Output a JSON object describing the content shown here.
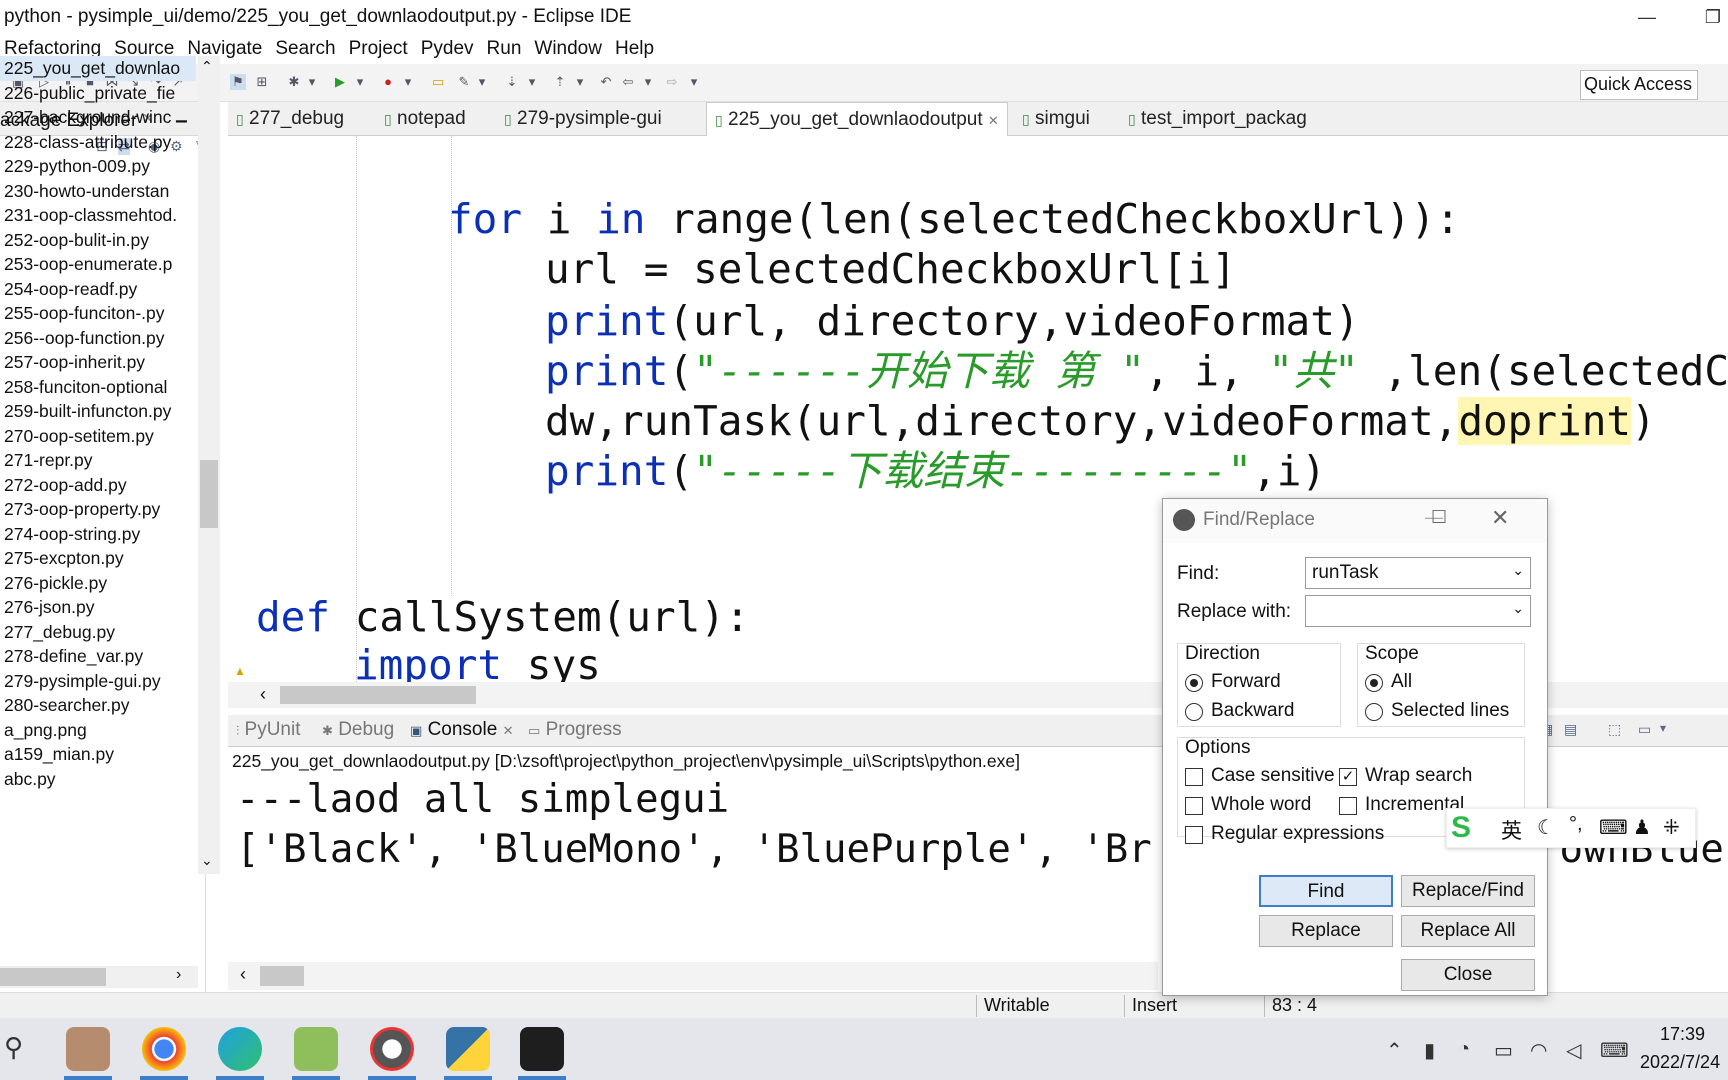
{
  "window": {
    "title": "python - pysimple_ui/demo/225_you_get_downlaodoutput.py - Eclipse IDE"
  },
  "menu": [
    "Refactoring",
    "Source",
    "Navigate",
    "Search",
    "Project",
    "Pydev",
    "Run",
    "Window",
    "Help"
  ],
  "toolbar": {
    "quick_access": "Quick Access"
  },
  "package_explorer": {
    "title": "ackage Explorer",
    "items": [
      "225_you_get_downlao",
      "226-public_private_fie",
      "227-background-winc",
      "228-class-attribute.py",
      "229-python-009.py",
      "230-howto-understan",
      "231-oop-classmehtod.",
      "252-oop-bulit-in.py",
      "253-oop-enumerate.p",
      "254-oop-readf.py",
      "255-oop-funciton-.py",
      "256--oop-function.py",
      "257-oop-inherit.py",
      "258-funciton-optional",
      "259-built-infuncton.py",
      "270-oop-setitem.py",
      "271-repr.py",
      "272-oop-add.py",
      "273-oop-property.py",
      "274-oop-string.py",
      "275-excpton.py",
      "276-pickle.py",
      "276-json.py",
      "277_debug.py",
      "278-define_var.py",
      "279-pysimple-gui.py",
      "280-searcher.py",
      "a_png.png",
      "a159_mian.py",
      "abc.py"
    ]
  },
  "editor_tabs": [
    "277_debug",
    "notepad",
    "279-pysimple-gui",
    "225_you_get_downlaodoutput",
    "simgui",
    "test_import_packag"
  ],
  "code": {
    "l1": {
      "kw1": "for",
      "t1": " i ",
      "kw2": "in",
      "t2": " range(len(selectedCheckboxUrl)):"
    },
    "l2": "url = selectedCheckboxUrl[i]",
    "l3": {
      "kw": "print",
      "rest": "(url, directory,videoFormat)"
    },
    "l4": {
      "kw": "print",
      "p1": "(",
      "s1": "\"------开始下载 第 \"",
      "p2": ", i, ",
      "s2": "\"共\"",
      "p3": " ,len(selectedChe"
    },
    "l5": {
      "pre": "dw,runTask(url,directory,videoFormat,",
      "hl": "doprint",
      "post": ")"
    },
    "l6": {
      "kw": "print",
      "p1": "(",
      "s1": "\"-----下载结束---------\"",
      "p2": ",i)"
    },
    "l7": {
      "kw": "def",
      "t": " callSystem(url):"
    },
    "l8": {
      "kw": "import",
      "t": " sys"
    }
  },
  "bottom_tabs": [
    "PyUnit",
    "Debug",
    "Console",
    "Progress"
  ],
  "console": {
    "path": "225_you_get_downlaodoutput.py [D:\\zsoft\\project\\python_project\\env\\pysimple_ui\\Scripts\\python.exe]",
    "line1": "---laod all simplegui",
    "line2a": "['Black', 'BlueMono', 'BluePurple', 'Br",
    "line2b": "rownBlue"
  },
  "status": {
    "writable": "Writable",
    "insert": "Insert",
    "position": "83 : 4"
  },
  "dialog": {
    "title": "Find/Replace",
    "find_label": "Find:",
    "find_value": "runTask",
    "replace_label": "Replace with:",
    "replace_value": "",
    "direction": {
      "title": "Direction",
      "forward": "Forward",
      "backward": "Backward"
    },
    "scope": {
      "title": "Scope",
      "all": "All",
      "selected": "Selected lines"
    },
    "options": {
      "title": "Options",
      "case": "Case sensitive",
      "wrap": "Wrap search",
      "whole": "Whole word",
      "incremental": "Incremental",
      "regex": "Regular expressions"
    },
    "buttons": {
      "find": "Find",
      "replace_find": "Replace/Find",
      "replace": "Replace",
      "replace_all": "Replace All",
      "close": "Close"
    }
  },
  "ime": {
    "lang": "英"
  },
  "clock": {
    "time": "17:39",
    "date": "2022/7/24"
  }
}
